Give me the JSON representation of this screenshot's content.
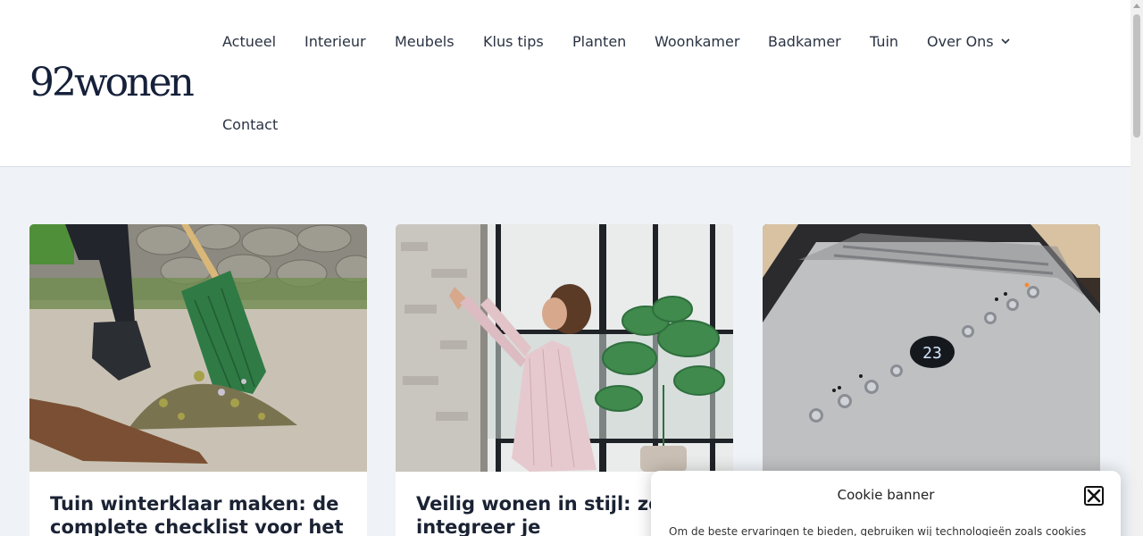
{
  "site": {
    "logo": "92wonen"
  },
  "nav": {
    "items": [
      {
        "label": "Actueel"
      },
      {
        "label": "Interieur"
      },
      {
        "label": "Meubels"
      },
      {
        "label": "Klus tips"
      },
      {
        "label": "Planten"
      },
      {
        "label": "Woonkamer"
      },
      {
        "label": "Badkamer"
      },
      {
        "label": "Tuin"
      },
      {
        "label": "Over Ons",
        "icon": "chevron-down-icon"
      },
      {
        "label": "Contact"
      }
    ]
  },
  "cards": [
    {
      "title": "Tuin winterklaar maken: de complete checklist voor het",
      "image": "garden-raking-image"
    },
    {
      "title": "Veilig wonen in stijl: zo integreer je",
      "image": "woman-touching-wall-image"
    },
    {
      "title": "",
      "image": "dehumidifier-control-panel-image"
    }
  ],
  "device_display": "23",
  "cookie": {
    "title": "Cookie banner",
    "text": "Om de beste ervaringen te bieden, gebruiken wij technologieën zoals cookies",
    "close_icon": "close-icon"
  },
  "colors": {
    "accent": "#15203a",
    "background": "#eff3f7"
  }
}
